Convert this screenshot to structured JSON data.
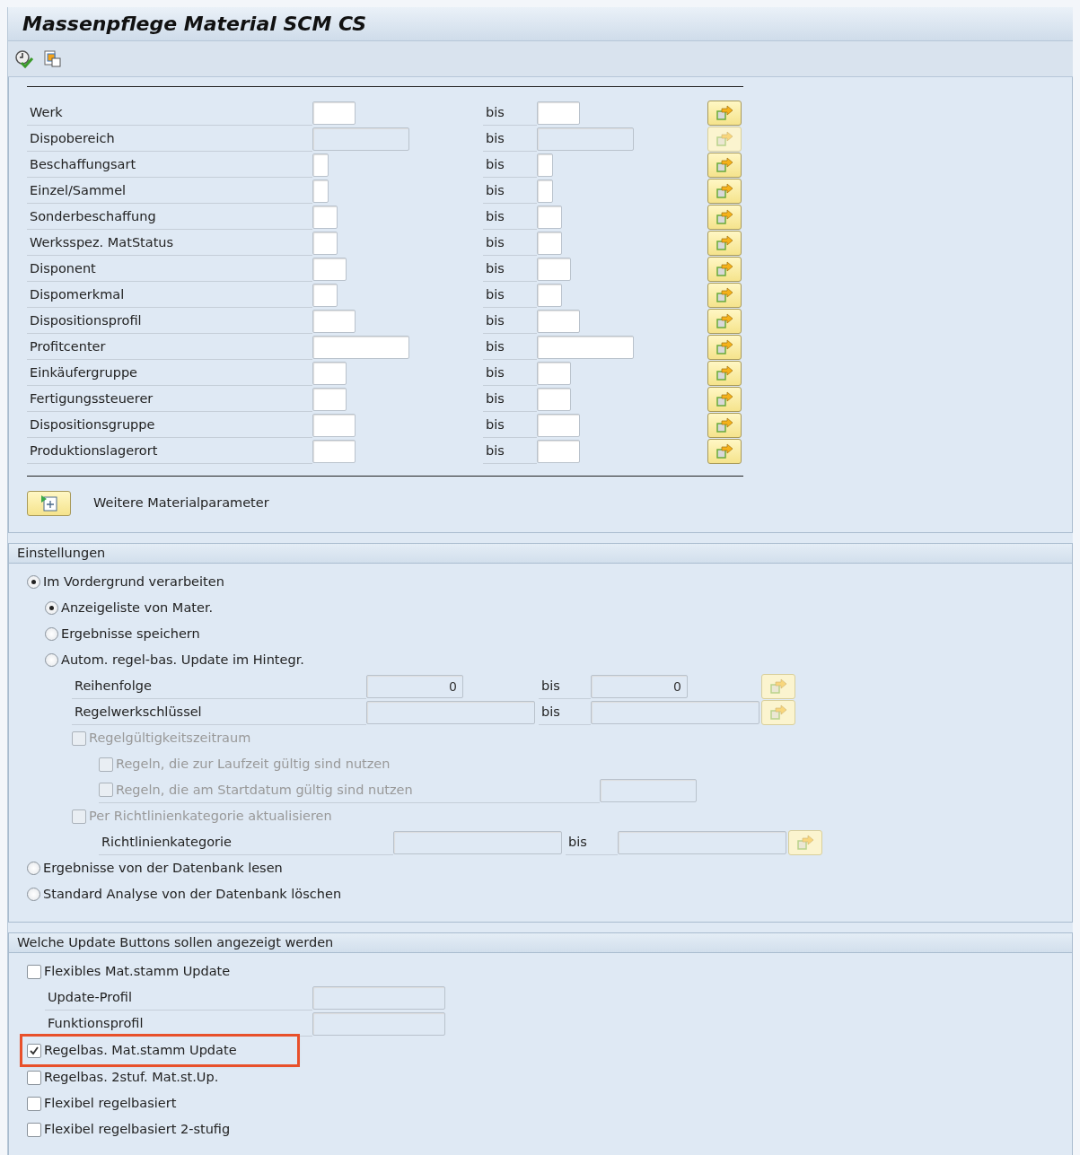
{
  "window": {
    "title": "Massenpflege Material SCM CS"
  },
  "selection": {
    "rows": [
      {
        "label": "Werk",
        "to_label": "bis",
        "disabled": false
      },
      {
        "label": "Dispobereich",
        "to_label": "bis",
        "disabled": true
      },
      {
        "label": "Beschaffungsart",
        "to_label": "bis",
        "disabled": false
      },
      {
        "label": "Einzel/Sammel",
        "to_label": "bis",
        "disabled": false
      },
      {
        "label": "Sonderbeschaffung",
        "to_label": "bis",
        "disabled": false
      },
      {
        "label": "Werksspez. MatStatus",
        "to_label": "bis",
        "disabled": false
      },
      {
        "label": "Disponent",
        "to_label": "bis",
        "disabled": false
      },
      {
        "label": "Dispomerkmal",
        "to_label": "bis",
        "disabled": false
      },
      {
        "label": "Dispositionsprofil",
        "to_label": "bis",
        "disabled": false
      },
      {
        "label": "Profitcenter",
        "to_label": "bis",
        "disabled": false
      },
      {
        "label": "Einkäufergruppe",
        "to_label": "bis",
        "disabled": false
      },
      {
        "label": "Fertigungssteuerer",
        "to_label": "bis",
        "disabled": false
      },
      {
        "label": "Dispositionsgruppe",
        "to_label": "bis",
        "disabled": false
      },
      {
        "label": "Produktionslagerort",
        "to_label": "bis",
        "disabled": false
      }
    ],
    "more_button": {
      "label": "Weitere Materialparameter"
    }
  },
  "settings": {
    "title": "Einstellungen",
    "items": [
      {
        "kind": "radio",
        "label": "Im Vordergrund verarbeiten",
        "selected": true,
        "children": [
          {
            "kind": "radio",
            "label": "Anzeigeliste von Mater.",
            "selected": true
          },
          {
            "kind": "radio",
            "label": "Ergebnisse speichern",
            "selected": false
          },
          {
            "kind": "radio",
            "label": "Autom. regel-bas. Update im Hintegr.",
            "selected": false,
            "children": [
              {
                "kind": "range",
                "label": "Reihenfolge",
                "from": "0",
                "to_label": "bis",
                "to": "0",
                "disabled": true
              },
              {
                "kind": "range",
                "label": "Regelwerkschlüssel",
                "to_label": "bis",
                "disabled": true
              },
              {
                "kind": "checkbox",
                "label": "Regelgültigkeitszeitraum",
                "checked": false,
                "disabled": true,
                "children": [
                  {
                    "kind": "checkbox",
                    "label": "Regeln, die zur Laufzeit gültig sind nutzen",
                    "checked": false,
                    "disabled": true
                  },
                  {
                    "kind": "check_field",
                    "label": "Regeln, die am Startdatum gültig sind nutzen",
                    "checked": false,
                    "disabled": true
                  }
                ]
              },
              {
                "kind": "checkbox",
                "label": "Per Richtlinienkategorie aktualisieren",
                "checked": false,
                "disabled": true,
                "children": [
                  {
                    "kind": "range",
                    "label": "Richtlinienkategorie",
                    "to_label": "bis",
                    "disabled": true
                  }
                ]
              }
            ]
          }
        ]
      },
      {
        "kind": "radio",
        "label": "Ergebnisse von der Datenbank lesen",
        "selected": false
      },
      {
        "kind": "radio",
        "label": "Standard Analyse von der Datenbank löschen",
        "selected": false
      }
    ]
  },
  "update_buttons": {
    "title": "Welche Update Buttons sollen angezeigt werden",
    "items": [
      {
        "kind": "checkbox",
        "label": "Flexibles Mat.stamm Update",
        "checked": false,
        "disabled": false,
        "children": [
          {
            "kind": "field",
            "label": "Update-Profil",
            "disabled": true
          },
          {
            "kind": "field",
            "label": "Funktionsprofil",
            "disabled": true
          }
        ]
      },
      {
        "kind": "checkbox",
        "label": "Regelbas. Mat.stamm Update",
        "checked": true,
        "disabled": false,
        "highlighted": true
      },
      {
        "kind": "checkbox",
        "label": "Regelbas. 2stuf. Mat.st.Up.",
        "checked": false,
        "disabled": false
      },
      {
        "kind": "checkbox",
        "label": "Flexibel regelbasiert",
        "checked": false,
        "disabled": false
      },
      {
        "kind": "checkbox",
        "label": "Flexibel regelbasiert 2-stufig",
        "checked": false,
        "disabled": false
      }
    ]
  }
}
